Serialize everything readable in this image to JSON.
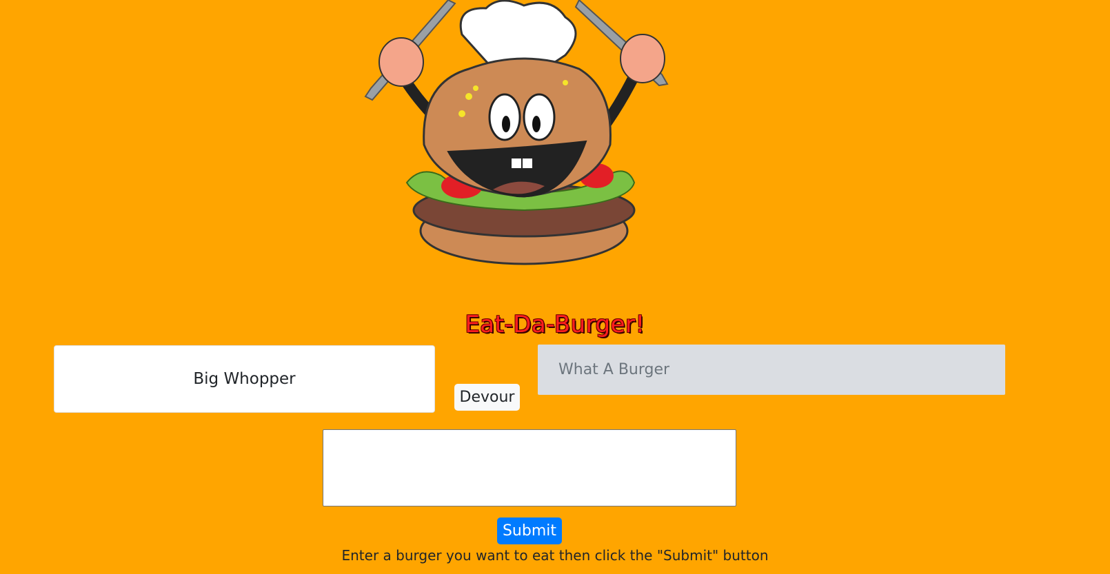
{
  "header": {
    "title": "Eat-Da-Burger!"
  },
  "uneaten_burgers": [
    {
      "name": "Big Whopper",
      "button_label": "Devour"
    }
  ],
  "eaten_burgers": [
    {
      "name": "What A Burger"
    }
  ],
  "form": {
    "input_value": "",
    "submit_label": "Submit",
    "instructions": "Enter a burger you want to eat then click the \"Submit\" button"
  },
  "colors": {
    "background": "#FFA500",
    "title": "#FF1E1E",
    "submit_button": "#007BFF",
    "eaten_card": "#DADDE2"
  }
}
